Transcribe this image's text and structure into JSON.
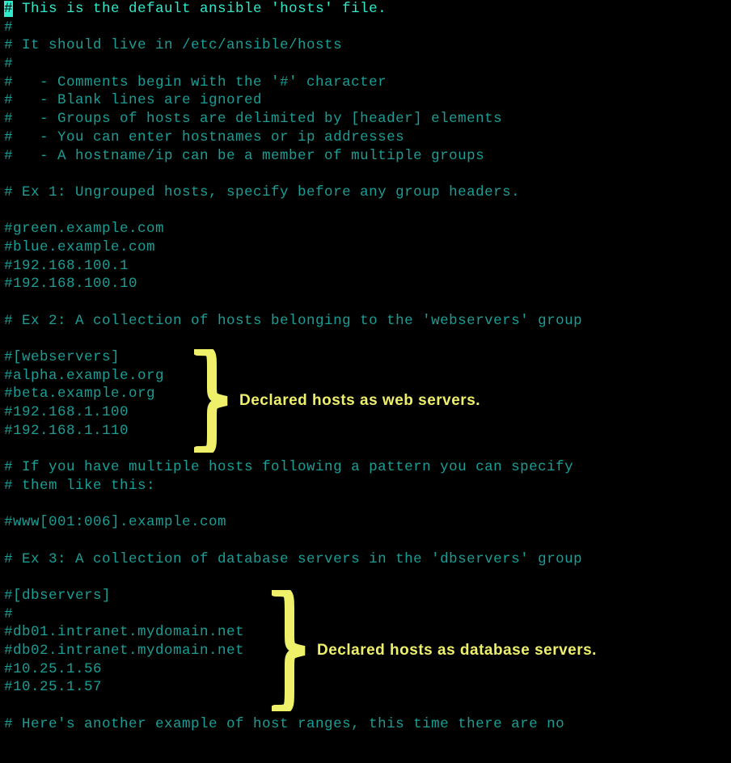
{
  "cursor_char": "#",
  "lines": {
    "l0_rest": " This is the default ansible 'hosts' file.",
    "l1": "#",
    "l2": "# It should live in /etc/ansible/hosts",
    "l3": "#",
    "l4": "#   - Comments begin with the '#' character",
    "l5": "#   - Blank lines are ignored",
    "l6": "#   - Groups of hosts are delimited by [header] elements",
    "l7": "#   - You can enter hostnames or ip addresses",
    "l8": "#   - A hostname/ip can be a member of multiple groups",
    "l9": "",
    "l10": "# Ex 1: Ungrouped hosts, specify before any group headers.",
    "l11": "",
    "l12": "#green.example.com",
    "l13": "#blue.example.com",
    "l14": "#192.168.100.1",
    "l15": "#192.168.100.10",
    "l16": "",
    "l17": "# Ex 2: A collection of hosts belonging to the 'webservers' group",
    "l18": "",
    "l19": "#[webservers]",
    "l20": "#alpha.example.org",
    "l21": "#beta.example.org",
    "l22": "#192.168.1.100",
    "l23": "#192.168.1.110",
    "l24": "",
    "l25": "# If you have multiple hosts following a pattern you can specify",
    "l26": "# them like this:",
    "l27": "",
    "l28": "#www[001:006].example.com",
    "l29": "",
    "l30": "# Ex 3: A collection of database servers in the 'dbservers' group",
    "l31": "",
    "l32": "#[dbservers]",
    "l33": "#",
    "l34": "#db01.intranet.mydomain.net",
    "l35": "#db02.intranet.mydomain.net",
    "l36": "#10.25.1.56",
    "l37": "#10.25.1.57",
    "l38": "",
    "l39": "# Here's another example of host ranges, this time there are no"
  },
  "annotations": {
    "webservers": "Declared hosts as web servers.",
    "dbservers": "Declared hosts as database servers."
  },
  "colors": {
    "background": "#000000",
    "text_bright": "#2feacb",
    "text_dim": "#1a9e95",
    "annotation": "#eef06a"
  }
}
